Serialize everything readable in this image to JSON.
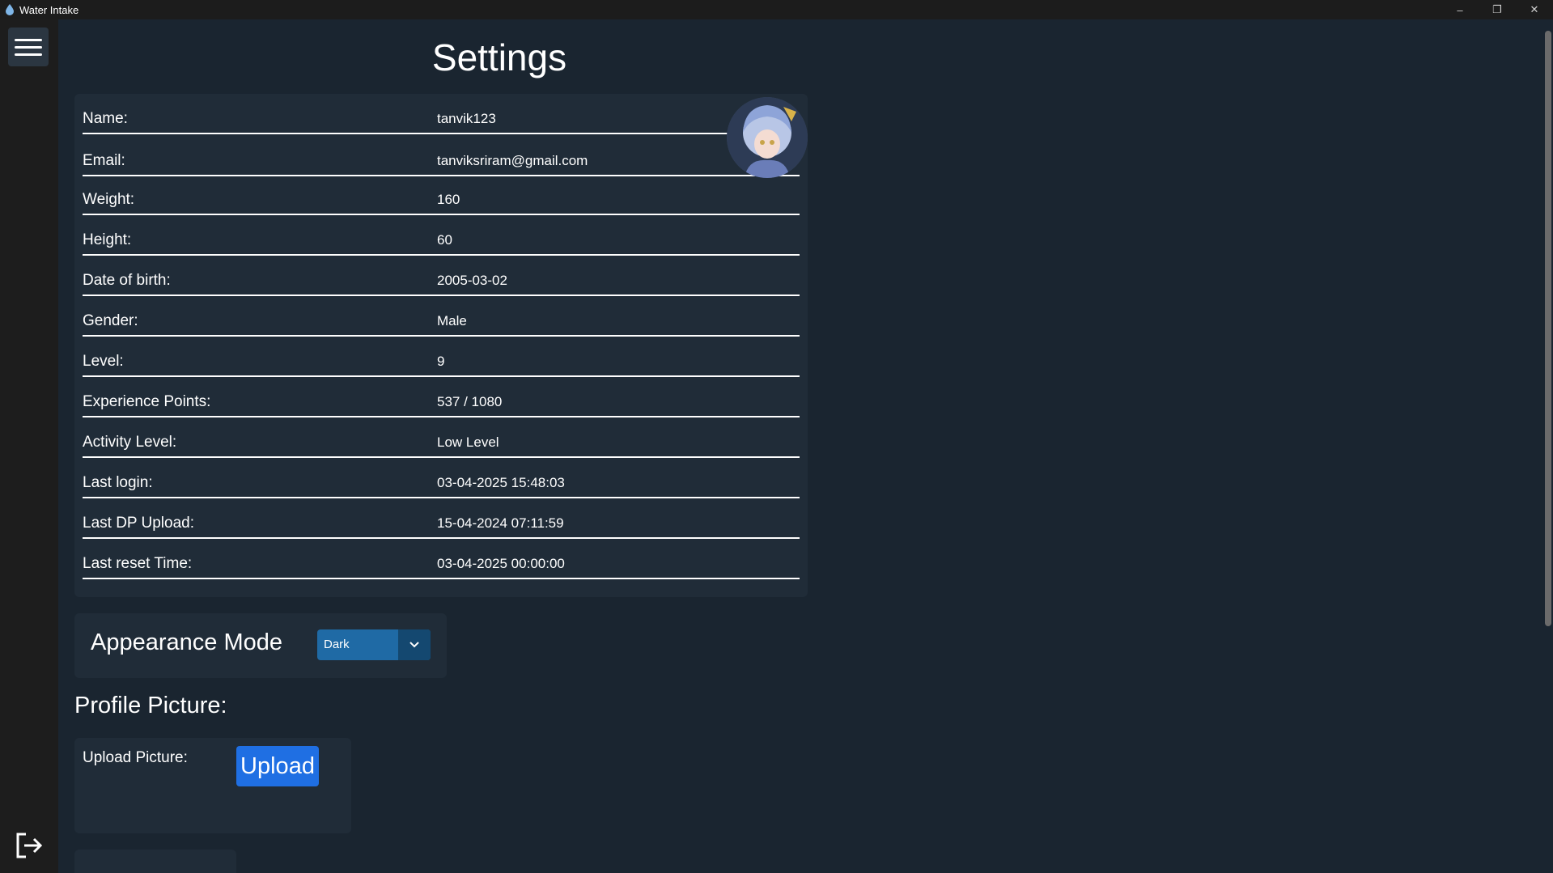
{
  "window": {
    "title": "Water Intake",
    "controls": {
      "minimize": "–",
      "restore": "❐",
      "close": "✕"
    }
  },
  "sidebar": {
    "menu_icon": "hamburger-menu-icon",
    "logout_icon": "logout-icon"
  },
  "page": {
    "title": "Settings"
  },
  "profile": {
    "fields": [
      {
        "label": "Name:",
        "value": "tanvik123"
      },
      {
        "label": "Email:",
        "value": "tanviksriram@gmail.com"
      },
      {
        "label": "Weight:",
        "value": "160"
      },
      {
        "label": "Height:",
        "value": "60"
      },
      {
        "label": "Date of birth:",
        "value": "2005-03-02"
      },
      {
        "label": "Gender:",
        "value": "Male"
      },
      {
        "label": "Level:",
        "value": "9"
      },
      {
        "label": "Experience Points:",
        "value": "537 / 1080"
      },
      {
        "label": "Activity Level:",
        "value": "Low Level"
      },
      {
        "label": "Last login:",
        "value": "03-04-2025 15:48:03"
      },
      {
        "label": "Last DP Upload:",
        "value": "15-04-2024 07:11:59"
      },
      {
        "label": "Last reset Time:",
        "value": "03-04-2025 00:00:00"
      }
    ]
  },
  "appearance": {
    "label": "Appearance Mode",
    "selected": "Dark",
    "arrow_icon": "chevron-down-icon"
  },
  "profile_picture": {
    "heading": "Profile Picture:",
    "upload_label": "Upload Picture:",
    "upload_button": "Upload"
  },
  "colors": {
    "accent": "#1f6aa5",
    "upload_button": "#1f6fe3",
    "card_background": "#202c38",
    "page_background": "#1a2530"
  }
}
